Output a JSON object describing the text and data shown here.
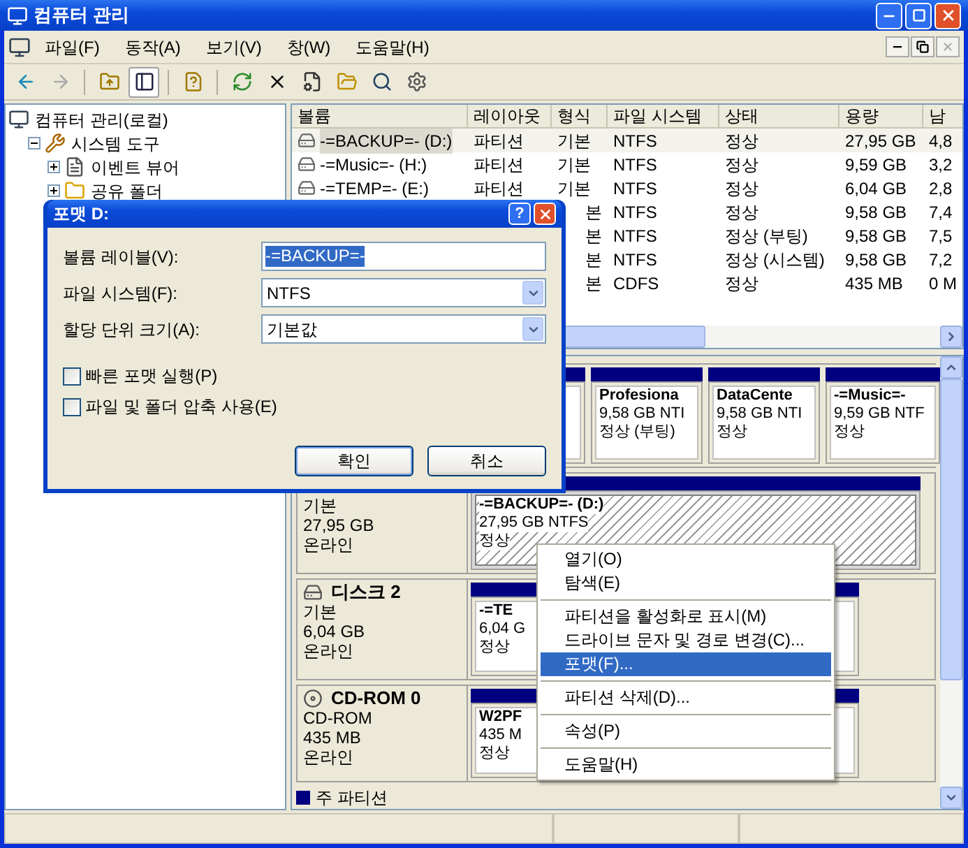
{
  "window": {
    "title": "컴퓨터 관리"
  },
  "menu": [
    "파일(F)",
    "동작(A)",
    "보기(V)",
    "창(W)",
    "도움말(H)"
  ],
  "tree": [
    {
      "label": "컴퓨터 관리(로컬)",
      "children": [
        {
          "label": "시스템 도구",
          "expanded": true,
          "children": [
            {
              "label": "이벤트 뷰어",
              "expanded": false
            },
            {
              "label": "공유 폴더",
              "expanded": false
            }
          ]
        }
      ]
    }
  ],
  "table": {
    "columns": [
      "볼륨",
      "레이아웃",
      "형식",
      "파일 시스템",
      "상태",
      "용량",
      "남"
    ],
    "rows": [
      {
        "volume": "-=BACKUP=- (D:)",
        "layout": "파티션",
        "type": "기본",
        "file_system": "NTFS",
        "status": "정상",
        "capacity": "27,95 GB",
        "free": "4,8",
        "selected": true
      },
      {
        "volume": "-=Music=- (H:)",
        "layout": "파티션",
        "type": "기본",
        "file_system": "NTFS",
        "status": "정상",
        "capacity": "9,59 GB",
        "free": "3,2",
        "selected": false
      },
      {
        "volume": "-=TEMP=- (E:)",
        "layout": "파티션",
        "type": "기본",
        "file_system": "NTFS",
        "status": "정상",
        "capacity": "6,04 GB",
        "free": "2,8",
        "selected": false
      },
      {
        "type": "본",
        "file_system": "NTFS",
        "status": "정상",
        "capacity": "9,58 GB",
        "free": "7,4",
        "selected": false
      },
      {
        "type": "본",
        "file_system": "NTFS",
        "status": "정상 (부팅)",
        "capacity": "9,58 GB",
        "free": "7,5",
        "selected": false
      },
      {
        "type": "본",
        "file_system": "NTFS",
        "status": "정상 (시스템)",
        "capacity": "9,58 GB",
        "free": "7,2",
        "selected": false
      },
      {
        "type": "본",
        "file_system": "CDFS",
        "status": "정상",
        "capacity": "435 MB",
        "free": "0 M",
        "selected": false
      }
    ]
  },
  "disks": [
    {
      "partitions": [
        {
          "selected": false
        },
        {
          "name": "Profesiona",
          "size": "9,58 GB NTI",
          "status": "정상 (부팅)",
          "selected": false
        },
        {
          "name": "DataCente",
          "size": "9,58 GB NTI",
          "status": "정상",
          "selected": false
        },
        {
          "name": "-=Music=-",
          "size": "9,59 GB NTF",
          "status": "정상",
          "selected": false
        }
      ]
    },
    {
      "info": [
        "기본",
        "27,95 GB",
        "온라인"
      ],
      "partitions": [
        {
          "name": "-=BACKUP=-  (D:)",
          "size": "27,95 GB NTFS",
          "status": "정상",
          "selected": true
        }
      ]
    },
    {
      "name": "디스크 2",
      "kind": "disk",
      "info": [
        "기본",
        "6,04 GB",
        "온라인"
      ],
      "partitions": [
        {
          "name": "-=TE",
          "size": "6,04 G",
          "status": "정상",
          "selected": false
        }
      ]
    },
    {
      "name": "CD-ROM 0",
      "kind": "cdrom",
      "info": [
        "CD-ROM",
        "435 MB",
        "온라인"
      ],
      "partitions": [
        {
          "name": "W2PF",
          "size": "435 M",
          "status": "정상",
          "selected": false
        }
      ]
    }
  ],
  "legend": [
    {
      "label": "주 파티션",
      "color": "#000080"
    }
  ],
  "dialog": {
    "title": "포맷 D:",
    "help_button": "?",
    "fields": [
      {
        "kind": "text",
        "label": "볼륨 레이블(V):",
        "value": "-=BACKUP=-",
        "highlighted": true
      },
      {
        "kind": "select",
        "label": "파일 시스템(F):",
        "value": "NTFS"
      },
      {
        "kind": "select",
        "label": "할당 단위 크기(A):",
        "value": "기본값"
      }
    ],
    "checkboxes": [
      {
        "label": "빠른 포맷 실행(P)",
        "checked": false
      },
      {
        "label": "파일 및 폴더 압축 사용(E)",
        "checked": false
      }
    ],
    "buttons": [
      {
        "label": "확인",
        "default": true
      },
      {
        "label": "취소",
        "default": false
      }
    ]
  },
  "context_menu": [
    {
      "kind": "item",
      "label": "열기(O)",
      "selected": false
    },
    {
      "kind": "item",
      "label": "탐색(E)",
      "selected": false
    },
    {
      "kind": "separator"
    },
    {
      "kind": "item",
      "label": "파티션을 활성화로 표시(M)",
      "selected": false
    },
    {
      "kind": "item",
      "label": "드라이브 문자 및 경로 변경(C)...",
      "selected": false
    },
    {
      "kind": "item",
      "label": "포맷(F)...",
      "selected": true
    },
    {
      "kind": "separator"
    },
    {
      "kind": "item",
      "label": "파티션 삭제(D)...",
      "selected": false
    },
    {
      "kind": "separator"
    },
    {
      "kind": "item",
      "label": "속성(P)",
      "selected": false
    },
    {
      "kind": "separator"
    },
    {
      "kind": "item",
      "label": "도움말(H)",
      "selected": false
    }
  ]
}
